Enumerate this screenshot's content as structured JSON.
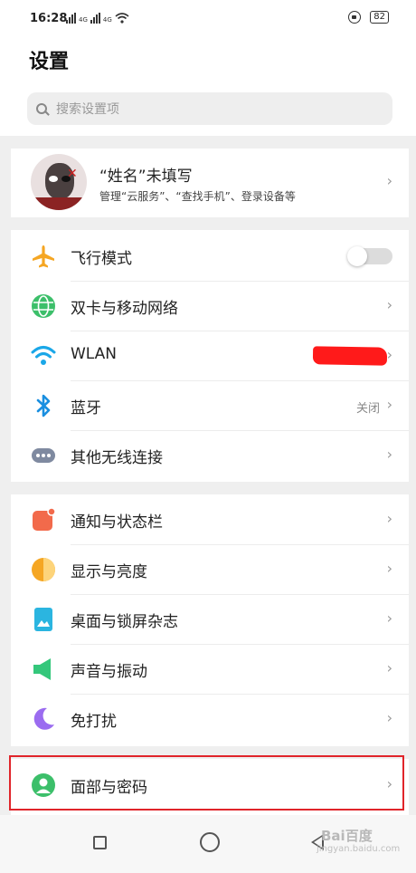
{
  "status_bar": {
    "time": "16:28",
    "signal_1": "4G",
    "signal_2": "4G",
    "battery": "82"
  },
  "header": {
    "title": "设置",
    "search_placeholder": "搜索设置项"
  },
  "profile": {
    "name": "“姓名”未填写",
    "subtitle": "管理“云服务”、“查找手机”、登录设备等"
  },
  "network_section": [
    {
      "label": "飞行模式",
      "icon": "airplane-icon",
      "control": "toggle",
      "on": false
    },
    {
      "label": "双卡与移动网络",
      "icon": "globe-icon"
    },
    {
      "label": "WLAN",
      "icon": "wifi-icon",
      "value_redacted": true
    },
    {
      "label": "蓝牙",
      "icon": "bluetooth-icon",
      "value": "关闭"
    },
    {
      "label": "其他无线连接",
      "icon": "more-dots-icon"
    }
  ],
  "display_section": [
    {
      "label": "通知与状态栏",
      "icon": "notification-icon"
    },
    {
      "label": "显示与亮度",
      "icon": "brightness-icon"
    },
    {
      "label": "桌面与锁屏杂志",
      "icon": "wallpaper-icon"
    },
    {
      "label": "声音与振动",
      "icon": "speaker-icon"
    },
    {
      "label": "免打扰",
      "icon": "moon-icon"
    }
  ],
  "security_section": [
    {
      "label": "面部与密码",
      "icon": "face-password-icon"
    }
  ],
  "chevron": "›",
  "watermark": {
    "text": "Bai百度",
    "sub": "jingyan.baidu.com"
  },
  "colors": {
    "airplane": "#f5a623",
    "globe": "#3cbf6a",
    "wifi": "#1aa7e8",
    "bluetooth": "#1a8fe0",
    "dots": "#7f8aa0",
    "notification": "#f26a4b",
    "brightness": "#f5a623",
    "wallpaper": "#2bb5e0",
    "speaker": "#34c77b",
    "moon": "#9b6cf0",
    "face": "#3cbf6a",
    "highlight_border": "#e0242a"
  }
}
